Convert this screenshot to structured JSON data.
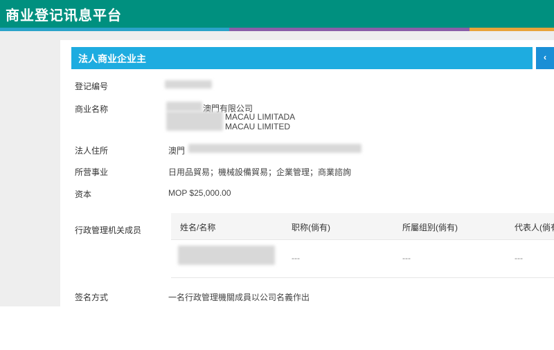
{
  "header": {
    "title": "商业登记讯息平台"
  },
  "panel": {
    "title": "法人商业企业主",
    "collapse_icon": "‹"
  },
  "fields": {
    "reg_no_label": "登记编号",
    "name_label": "商业名称",
    "name_line1": "澳門有限公司",
    "name_line2": "MACAU LIMITADA",
    "name_line3": "MACAU LIMITED",
    "address_label": "法人住所",
    "address_value": "澳門",
    "business_label": "所营事业",
    "business_value": "日用品貿易；機械設備貿易；企業管理；商業諮詢",
    "capital_label": "资本",
    "capital_value": "MOP $25,000.00",
    "admin_label": "行政管理机关成员",
    "signature_label": "签名方式",
    "signature_value": "一名行政管理機關成員以公司名義作出"
  },
  "admin_table": {
    "headers": [
      "姓名/名称",
      "职称(倘有)",
      "所屬组别(倘有)",
      "代表人(倘有"
    ],
    "rows": [
      [
        "",
        "---",
        "---",
        "---"
      ]
    ]
  },
  "colors": {
    "header": "#00907f",
    "panel": "#1eace0",
    "stripe1": "#2aa3c9",
    "stripe2": "#8a5ea8",
    "stripe3": "#e8a33a"
  }
}
